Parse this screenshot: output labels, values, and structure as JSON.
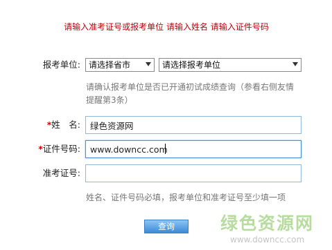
{
  "error_message": "请输入准考证号或报考单位 请输入姓名 请输入证件号码",
  "unit": {
    "label": "报考单位:",
    "city_select": "请选择省市",
    "unit_select": "请选择报考单位",
    "hint": "请确认报考单位是否已开通初试成绩查询（参看右侧友情提醒第3条）"
  },
  "name": {
    "required_mark": "*",
    "label": "姓　名:",
    "value": "绿色资源网"
  },
  "id_number": {
    "required_mark": "*",
    "label": "证件号码:",
    "value": "www.downcc.com"
  },
  "exam_number": {
    "label": "准考证号:",
    "value": ""
  },
  "footer_hint": "姓名、证件号码必填，报考单位和准考证号至少填一项",
  "submit_label": "查询",
  "watermark": {
    "title": "绿色资源网",
    "url": "www.downcc.com"
  }
}
